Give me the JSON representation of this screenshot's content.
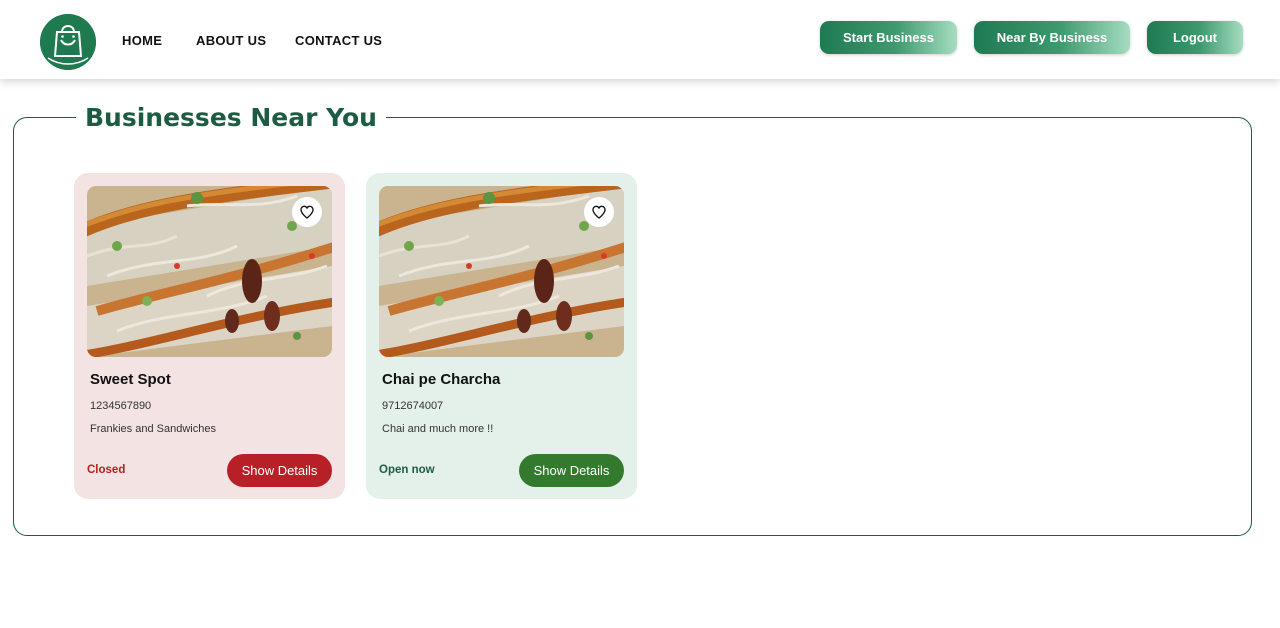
{
  "nav": {
    "links": [
      "HOME",
      "ABOUT US",
      "CONTACT US"
    ],
    "buttons": [
      "Start Business",
      "Near By Business",
      "Logout"
    ]
  },
  "main": {
    "title": "Businesses Near You"
  },
  "cards": [
    {
      "name": "Sweet Spot",
      "phone": "1234567890",
      "description": "Frankies and Sandwiches",
      "status": "Closed",
      "button": "Show Details",
      "card_bg": "#f4e3e3",
      "status_color": "#b22222",
      "button_color": "#b82027"
    },
    {
      "name": "Chai pe Charcha",
      "phone": "9712674007",
      "description": "Chai and much more !!",
      "status": "Open now",
      "button": "Show Details",
      "card_bg": "#e3f1ea",
      "status_color": "#1d5c42",
      "button_color": "#347a2e"
    }
  ],
  "colors": {
    "brand_green": "#1f7a4f",
    "title_green": "#1d5c42"
  },
  "icons": [
    "shopping-bag-logo",
    "heart-icon"
  ]
}
